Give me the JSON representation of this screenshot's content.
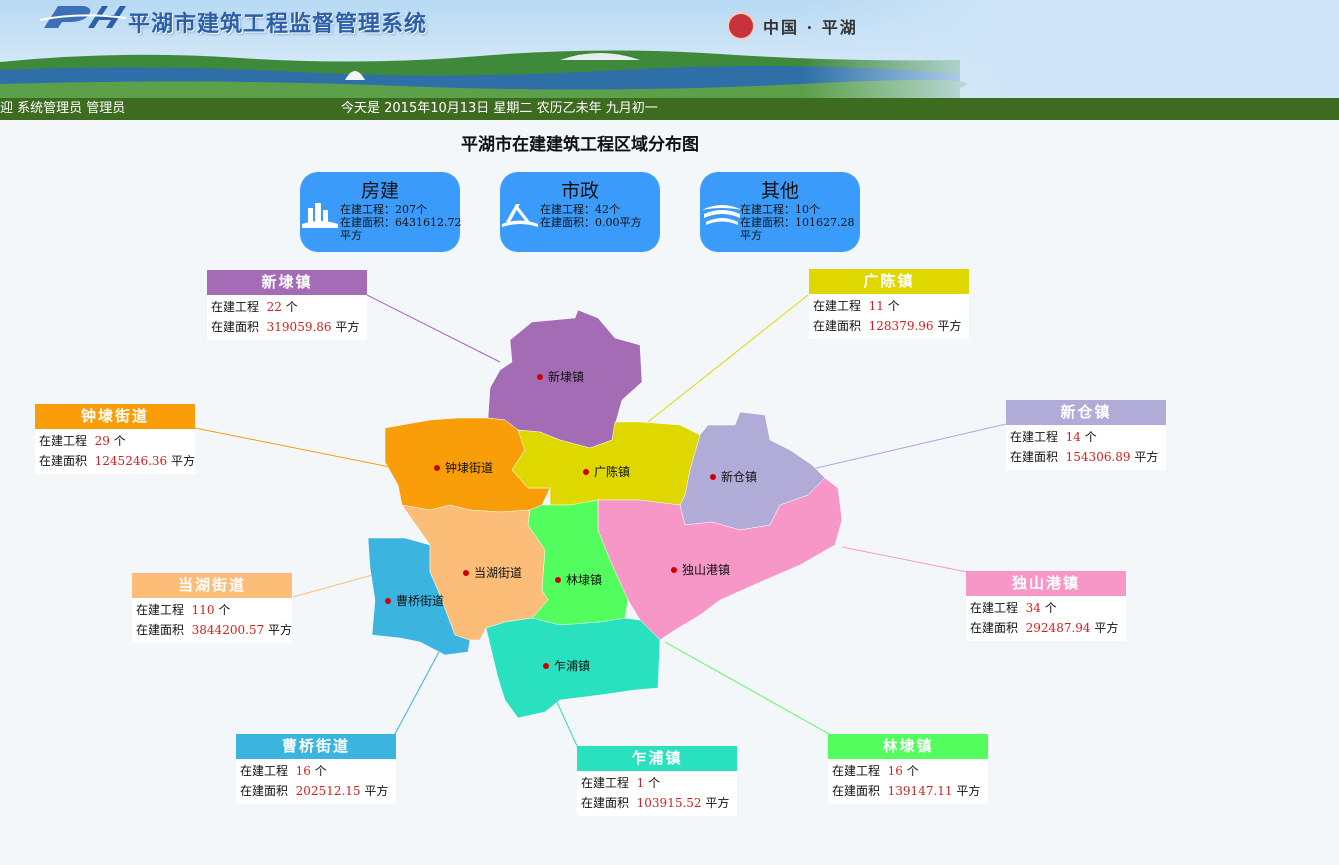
{
  "header": {
    "system_title": "平湖市建筑工程监督管理系统",
    "region_text": "中国 · 平湖"
  },
  "statusbar": {
    "welcome": "迎 系统管理员  管理员",
    "date": "今天是 2015年10月13日 星期二 农历乙未年 九月初一"
  },
  "map": {
    "title": "平湖市在建建筑工程区域分布图"
  },
  "categories": [
    {
      "name": "房建",
      "projects": "在建工程：207个",
      "area": "在建面积：6431612.72",
      "unit": "平方",
      "icon": "building-icon"
    },
    {
      "name": "市政",
      "projects": "在建工程：42个",
      "area": "在建面积：0.00平方",
      "unit": "",
      "icon": "bridge-icon"
    },
    {
      "name": "其他",
      "projects": "在建工程：10个",
      "area": "在建面积：101627.28",
      "unit": "平方",
      "icon": "stadium-icon"
    }
  ],
  "labels": {
    "projects": "在建工程",
    "area": "在建面积",
    "count_unit": "个",
    "area_unit": "平方"
  },
  "regions": [
    {
      "id": "xindai",
      "name": "新埭镇",
      "map_label": "新埭镇",
      "projects": "22",
      "area": "319059.86",
      "color": "#a56cb6"
    },
    {
      "id": "guangchen",
      "name": "广陈镇",
      "map_label": "广陈镇",
      "projects": "11",
      "area": "128379.96",
      "color": "#dfd800"
    },
    {
      "id": "zhongdai",
      "name": "钟埭街道",
      "map_label": "钟埭街道",
      "projects": "29",
      "area": "1245246.36",
      "color": "#f99d08"
    },
    {
      "id": "xincang",
      "name": "新仓镇",
      "map_label": "新仓镇",
      "projects": "14",
      "area": "154306.89",
      "color": "#b0acd7"
    },
    {
      "id": "danghu",
      "name": "当湖街道",
      "map_label": "当湖街道",
      "projects": "110",
      "area": "3844200.57",
      "color": "#fbbd77"
    },
    {
      "id": "dushangang",
      "name": "独山港镇",
      "map_label": "独山港镇",
      "projects": "34",
      "area": "292487.94",
      "color": "#f797c8"
    },
    {
      "id": "caoqiao",
      "name": "曹桥街道",
      "map_label": "曹桥街道",
      "projects": "16",
      "area": "202512.15",
      "color": "#3bb4df"
    },
    {
      "id": "zhapu",
      "name": "乍浦镇",
      "map_label": "乍浦镇",
      "projects": "1",
      "area": "103915.52",
      "color": "#29e1bf"
    },
    {
      "id": "lindai",
      "name": "林埭镇",
      "map_label": "林埭镇",
      "projects": "16",
      "area": "139147.11",
      "color": "#53fd5d"
    }
  ]
}
